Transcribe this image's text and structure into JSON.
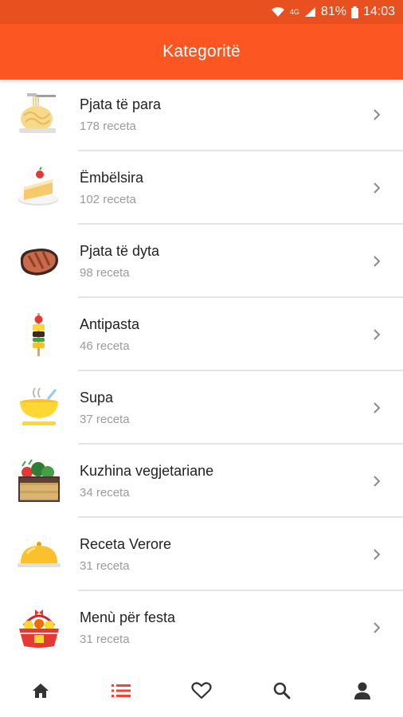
{
  "status_bar": {
    "battery_percent": "81%",
    "time": "14:03",
    "network_label": "4G",
    "icons": [
      "wifi-icon",
      "signal-icon",
      "battery-icon"
    ]
  },
  "app_bar": {
    "title": "Kategoritë"
  },
  "categories": [
    {
      "title": "Pjata të para",
      "count": "178 receta",
      "icon": "pasta-icon"
    },
    {
      "title": "Ëmbëlsira",
      "count": "102 receta",
      "icon": "cake-icon"
    },
    {
      "title": "Pjata të dyta",
      "count": "98 receta",
      "icon": "steak-icon"
    },
    {
      "title": "Antipasta",
      "count": "46 receta",
      "icon": "skewer-icon"
    },
    {
      "title": "Supa",
      "count": "37 receta",
      "icon": "soup-bowl-icon"
    },
    {
      "title": "Kuzhina vegjetariane",
      "count": "34 receta",
      "icon": "vegetable-crate-icon"
    },
    {
      "title": "Receta Verore",
      "count": "31 receta",
      "icon": "cloche-icon"
    },
    {
      "title": "Menù për festa",
      "count": "31 receta",
      "icon": "gift-basket-icon"
    }
  ],
  "bottom_nav": {
    "items": [
      "home-icon",
      "list-icon",
      "heart-icon",
      "search-icon",
      "profile-icon"
    ],
    "active_index": 1
  },
  "colors": {
    "status_bar": "#e8511f",
    "app_bar": "#fc5722",
    "accent_active": "#f44336",
    "nav_icon": "#333333",
    "chevron": "#8a8a8a"
  }
}
